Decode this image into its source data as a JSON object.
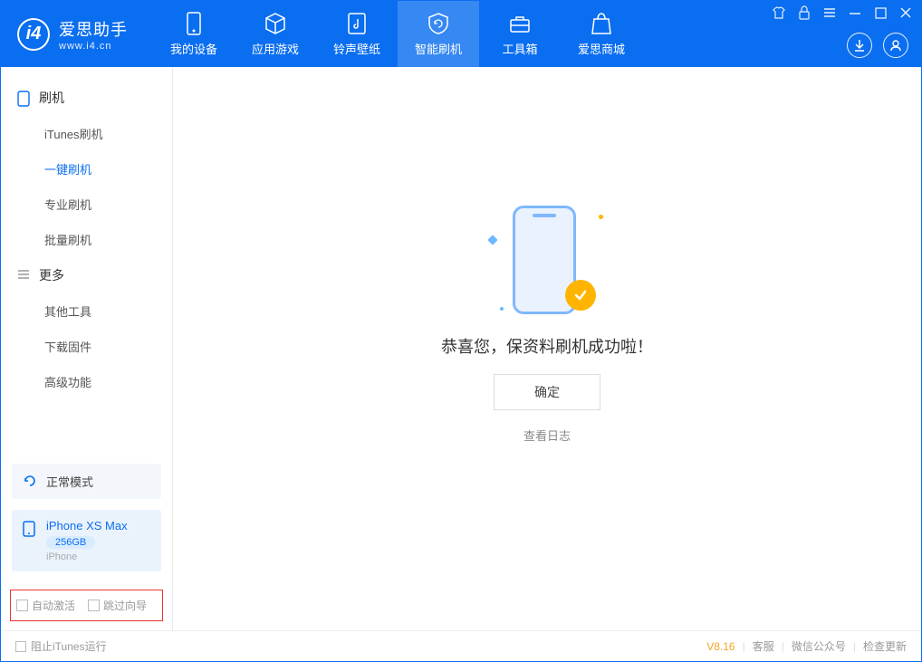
{
  "brand": {
    "name": "爱思助手",
    "url": "www.i4.cn"
  },
  "tabs": {
    "device": "我的设备",
    "apps": "应用游戏",
    "ring": "铃声壁纸",
    "flash": "智能刷机",
    "tools": "工具箱",
    "store": "爱思商城"
  },
  "sidebar": {
    "section_flash": "刷机",
    "items": {
      "itunes": "iTunes刷机",
      "oneclick": "一键刷机",
      "pro": "专业刷机",
      "batch": "批量刷机"
    },
    "section_more": "更多",
    "more_items": {
      "other": "其他工具",
      "firmware": "下载固件",
      "advanced": "高级功能"
    }
  },
  "device_mode": {
    "label": "正常模式"
  },
  "device_info": {
    "name": "iPhone XS Max",
    "capacity": "256GB",
    "type": "iPhone"
  },
  "checks": {
    "auto_activate": "自动激活",
    "skip_guide": "跳过向导"
  },
  "main": {
    "message": "恭喜您，保资料刷机成功啦！",
    "ok": "确定",
    "log": "查看日志"
  },
  "footer": {
    "block_itunes": "阻止iTunes运行",
    "version": "V8.16",
    "support": "客服",
    "wechat": "微信公众号",
    "update": "检查更新"
  }
}
